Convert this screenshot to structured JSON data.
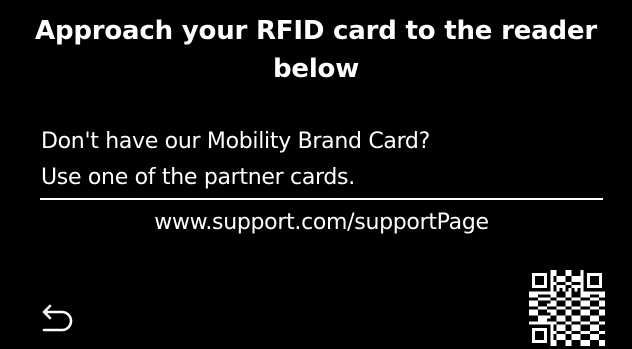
{
  "header": {
    "title_line1": "Approach your RFID card to the reader",
    "title_line2": "below"
  },
  "info": {
    "line1": "Don't have our Mobility Brand Card?",
    "line2": "Use one of the partner cards."
  },
  "support": {
    "url": "www.support.com/supportPage"
  },
  "controls": {
    "back_icon": "back-arrow-icon"
  },
  "qr": {
    "icon": "qr-code"
  },
  "colors": {
    "background": "#000000",
    "foreground": "#ffffff"
  }
}
